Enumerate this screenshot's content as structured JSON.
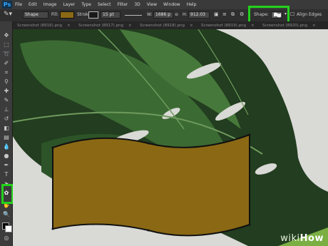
{
  "app": {
    "logo": "Ps"
  },
  "menu": [
    "File",
    "Edit",
    "Image",
    "Layer",
    "Type",
    "Select",
    "Filter",
    "3D",
    "View",
    "Window",
    "Help"
  ],
  "options": {
    "mode": "Shape",
    "fill_label": "Fill:",
    "fill_color": "#8b6914",
    "stroke_label": "Stroke:",
    "stroke_width": "15 pt",
    "w_label": "W:",
    "w_value": "1686 p",
    "h_label": "H:",
    "h_value": "912.03",
    "shape_label": "Shape:",
    "align_edges": "Align Edges"
  },
  "tabs": [
    "Screenshot (8916).png",
    "Screenshot (8917).png",
    "Screenshot (8918).png",
    "Screenshot (8919).png",
    "Screenshot (8920).png"
  ],
  "colors": {
    "accent_highlight": "#23d11c",
    "banner_fill": "#8b6914"
  },
  "watermark": {
    "part1": "wiki",
    "part2": "How"
  }
}
